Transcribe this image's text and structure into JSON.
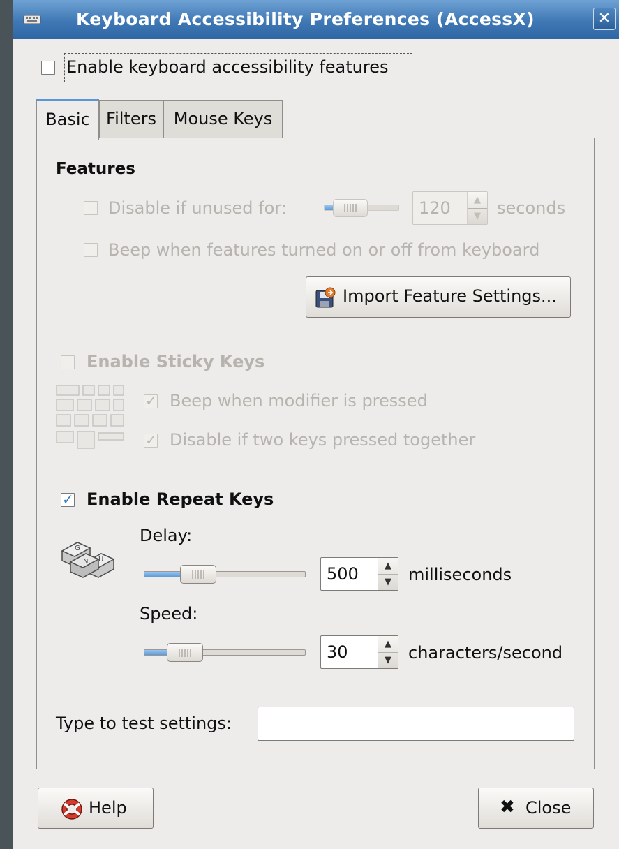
{
  "window": {
    "title": "Keyboard Accessibility Preferences (AccessX)",
    "close_glyph": "✕"
  },
  "enable_accessibility": {
    "label": "Enable keyboard accessibility features",
    "checked": false
  },
  "tabs": [
    {
      "label": "Basic",
      "active": true
    },
    {
      "label": "Filters",
      "active": false
    },
    {
      "label": "Mouse Keys",
      "active": false
    }
  ],
  "features": {
    "heading": "Features",
    "disable_unused": {
      "label": "Disable if unused for:",
      "checked": false,
      "value": "120",
      "unit": "seconds",
      "slider_fraction": 0.25
    },
    "beep_features": {
      "label": "Beep when features turned on or off from keyboard",
      "checked": false
    },
    "import_button": "Import Feature Settings..."
  },
  "sticky_keys": {
    "label": "Enable Sticky Keys",
    "checked": false,
    "beep_modifier": {
      "label": "Beep when modifier is pressed",
      "checked": true
    },
    "disable_two_keys": {
      "label": "Disable if two keys pressed together",
      "checked": true
    }
  },
  "repeat_keys": {
    "label": "Enable Repeat Keys",
    "checked": true,
    "delay": {
      "label": "Delay:",
      "value": "500",
      "unit": "milliseconds",
      "slider_fraction": 0.3
    },
    "speed": {
      "label": "Speed:",
      "value": "30",
      "unit": "characters/second",
      "slider_fraction": 0.25
    }
  },
  "test": {
    "label": "Type to test settings:",
    "value": ""
  },
  "buttons": {
    "help": "Help",
    "close": "Close"
  },
  "icons": {
    "window": "keyboard-icon",
    "import": "disk-import-icon",
    "sticky": "sticky-keys-icon",
    "repeat": "repeat-keys-icon",
    "help": "lifebuoy-icon",
    "close": "x-icon"
  },
  "colors": {
    "titlebar": "#3f78b5",
    "accent": "#5a95d6",
    "window_bg": "#edeceb"
  }
}
